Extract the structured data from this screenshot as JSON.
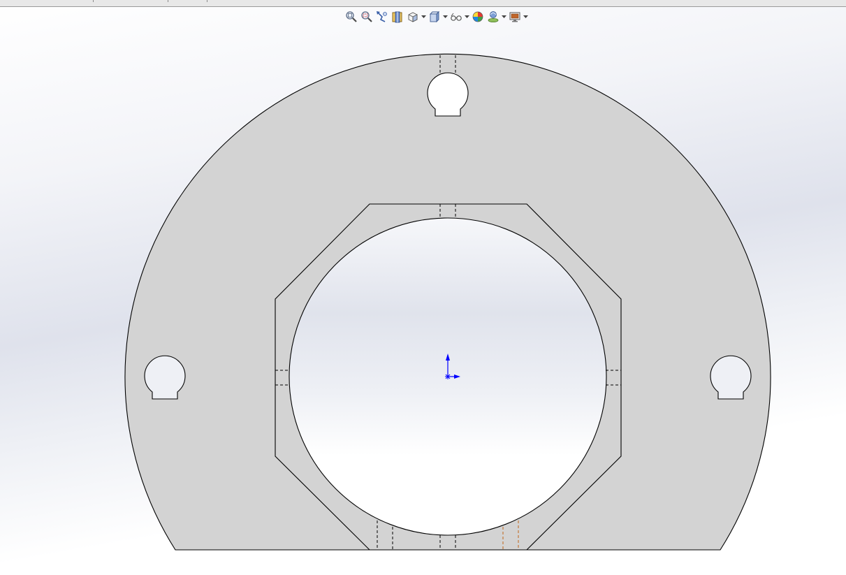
{
  "viewport": {
    "background_top": "#ffffff",
    "background_band": "#dfe2ec",
    "part_fill": "#d3d3d3",
    "edge_color": "#000000",
    "hidden_edge_color": "#000000",
    "highlight_hidden_edge_color": "#c0661a",
    "triad_color": "#0000ff"
  },
  "heads_up_toolbar": {
    "buttons": [
      {
        "name": "zoom-to-fit-icon",
        "dropdown": false
      },
      {
        "name": "zoom-to-area-icon",
        "dropdown": false
      },
      {
        "name": "previous-view-icon",
        "dropdown": false
      },
      {
        "name": "section-view-icon",
        "dropdown": false
      },
      {
        "name": "view-orientation-icon",
        "dropdown": true
      },
      {
        "name": "display-style-icon",
        "dropdown": true
      },
      {
        "name": "hide-show-items-icon",
        "dropdown": true
      },
      {
        "name": "edit-appearance-icon",
        "dropdown": false
      },
      {
        "name": "apply-scene-icon",
        "dropdown": true
      },
      {
        "name": "view-settings-icon",
        "dropdown": true
      }
    ]
  }
}
